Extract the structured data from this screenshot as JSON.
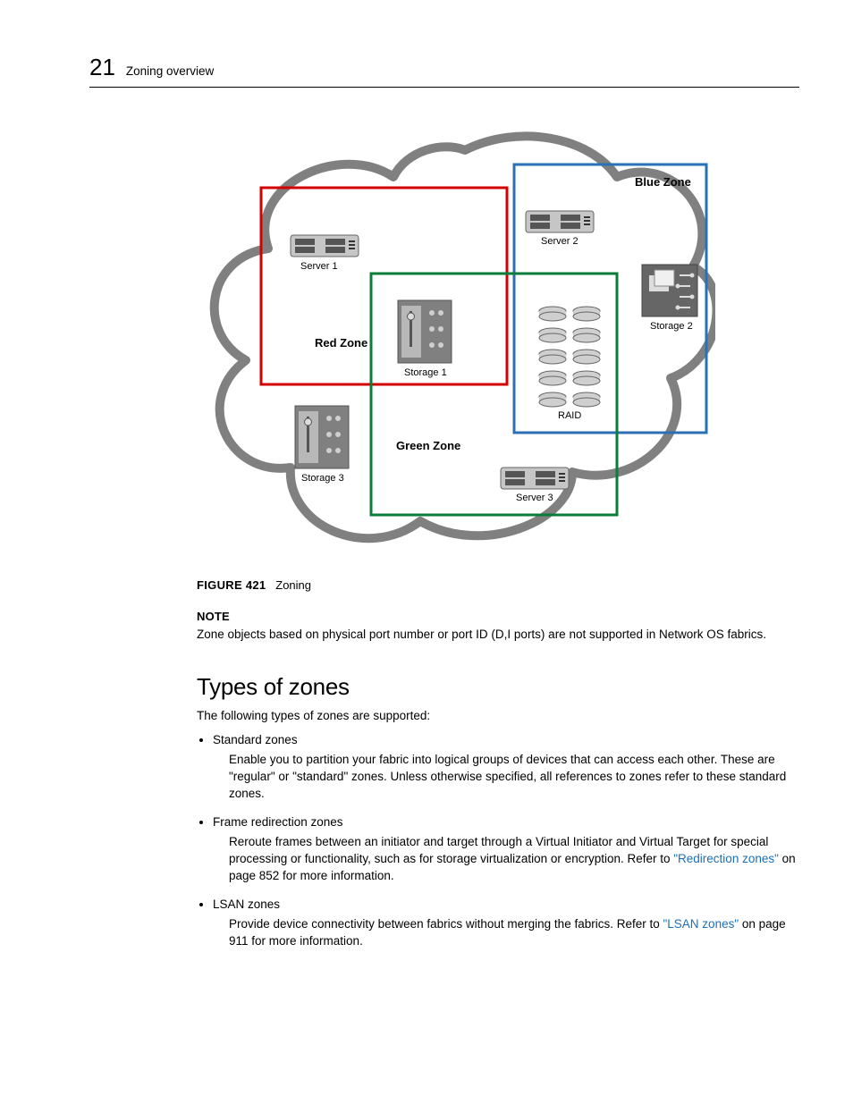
{
  "header": {
    "chapter_number": "21",
    "chapter_title": "Zoning overview"
  },
  "figure": {
    "caption_label": "FIGURE 421",
    "caption_text": "Zoning",
    "diagram": {
      "zone_labels": {
        "red": "Red Zone",
        "blue": "Blue Zone",
        "green": "Green Zone"
      },
      "nodes": {
        "server1": "Server 1",
        "server2": "Server 2",
        "server3": "Server 3",
        "storage1": "Storage 1",
        "storage2": "Storage 2",
        "storage3": "Storage 3",
        "raid": "RAID"
      }
    }
  },
  "note": {
    "label": "NOTE",
    "text": "Zone objects based on physical port number or port ID (D,I ports) are not supported in Network OS fabrics."
  },
  "section": {
    "heading": "Types of zones",
    "intro": "The following types of zones are supported:",
    "bullets": [
      {
        "title": "Standard zones",
        "desc_pre": "Enable you to partition your fabric into logical groups of devices that can access each other. These are \"regular\" or \"standard\" zones. Unless otherwise specified, all references to zones refer to these standard zones.",
        "link": "",
        "desc_post": ""
      },
      {
        "title": "Frame redirection zones",
        "desc_pre": "Reroute frames between an initiator and target through a Virtual Initiator and Virtual Target for special processing or functionality, such as for storage virtualization or encryption. Refer to ",
        "link": "\"Redirection zones\"",
        "desc_post": " on page 852 for more information."
      },
      {
        "title": "LSAN zones",
        "desc_pre": "Provide device connectivity between fabrics without merging the fabrics. Refer to ",
        "link": "\"LSAN zones\"",
        "desc_post": " on page 911 for more information."
      }
    ]
  }
}
